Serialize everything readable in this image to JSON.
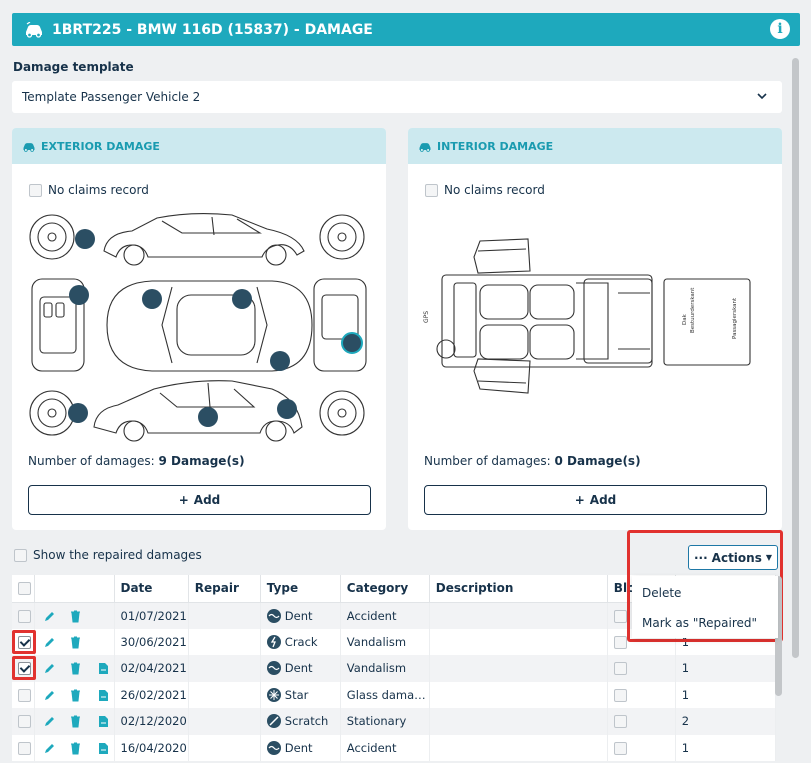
{
  "header": {
    "title": "1BRT225 - BMW 116D (15837) - DAMAGE",
    "info_icon": "info-icon"
  },
  "template": {
    "label": "Damage template",
    "value": "Template Passenger Vehicle 2"
  },
  "exterior": {
    "title": "EXTERIOR DAMAGE",
    "no_claims": "No claims record",
    "num_label": "Number of damages: ",
    "num_value": "9 Damage(s)",
    "add": "Add"
  },
  "interior": {
    "title": "INTERIOR DAMAGE",
    "no_claims": "No claims record",
    "num_label": "Number of damages: ",
    "num_value": "0 Damage(s)",
    "add": "Add",
    "labels": {
      "dak": "Dak",
      "bestuurderskant": "Bestuurderskant",
      "passagierskant": "Passagierskant",
      "gps": "GPS"
    }
  },
  "show_repaired": "Show the repaired damages",
  "actions": {
    "button": "Actions",
    "menu": [
      "Delete",
      "Mark as \"Repaired\""
    ]
  },
  "table": {
    "headers": [
      "",
      "",
      "Date",
      "Repair",
      "Type",
      "Category",
      "Description",
      "Bloc",
      ""
    ],
    "rows": [
      {
        "checked": false,
        "date": "01/07/2021",
        "type": "Dent",
        "category": "Accident",
        "qty": "",
        "file": false
      },
      {
        "checked": true,
        "date": "30/06/2021",
        "type": "Crack",
        "category": "Vandalism",
        "qty": "1",
        "file": false
      },
      {
        "checked": true,
        "date": "02/04/2021",
        "type": "Dent",
        "category": "Vandalism",
        "qty": "1",
        "file": true
      },
      {
        "checked": false,
        "date": "26/02/2021",
        "type": "Star",
        "category": "Glass dama…",
        "qty": "1",
        "file": true
      },
      {
        "checked": false,
        "date": "02/12/2020",
        "type": "Scratch",
        "category": "Stationary",
        "qty": "2",
        "file": true
      },
      {
        "checked": false,
        "date": "16/04/2020",
        "type": "Dent",
        "category": "Accident",
        "qty": "1",
        "file": true
      }
    ]
  },
  "colors": {
    "brand": "#1ea9bd",
    "panel_header": "#cce9ef",
    "highlight": "#e1322f",
    "marker": "#2b4e63"
  }
}
